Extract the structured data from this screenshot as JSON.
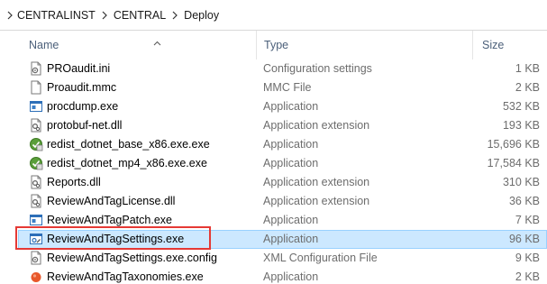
{
  "breadcrumb": {
    "items": [
      "CENTRALINST",
      "CENTRAL",
      "Deploy"
    ]
  },
  "columns": {
    "name": "Name",
    "type": "Type",
    "size": "Size",
    "sorted_by": "name",
    "sort_direction": "ascending"
  },
  "files": [
    {
      "name": "PROaudit.ini",
      "type": "Configuration settings",
      "size": "1 KB",
      "icon": "settings-file-icon",
      "selected": false
    },
    {
      "name": "Proaudit.mmc",
      "type": "MMC File",
      "size": "2 KB",
      "icon": "blank-file-icon",
      "selected": false
    },
    {
      "name": "procdump.exe",
      "type": "Application",
      "size": "532 KB",
      "icon": "application-icon",
      "selected": false
    },
    {
      "name": "protobuf-net.dll",
      "type": "Application extension",
      "size": "193 KB",
      "icon": "dll-file-icon",
      "selected": false
    },
    {
      "name": "redist_dotnet_base_x86.exe.exe",
      "type": "Application",
      "size": "15,696 KB",
      "icon": "installer-icon",
      "selected": false
    },
    {
      "name": "redist_dotnet_mp4_x86.exe.exe",
      "type": "Application",
      "size": "17,584 KB",
      "icon": "installer-icon",
      "selected": false
    },
    {
      "name": "Reports.dll",
      "type": "Application extension",
      "size": "310 KB",
      "icon": "dll-file-icon",
      "selected": false
    },
    {
      "name": "ReviewAndTagLicense.dll",
      "type": "Application extension",
      "size": "36 KB",
      "icon": "dll-file-icon",
      "selected": false
    },
    {
      "name": "ReviewAndTagPatch.exe",
      "type": "Application",
      "size": "7 KB",
      "icon": "application-icon",
      "selected": false
    },
    {
      "name": "ReviewAndTagSettings.exe",
      "type": "Application",
      "size": "96 KB",
      "icon": "app-settings-icon",
      "selected": true
    },
    {
      "name": "ReviewAndTagSettings.exe.config",
      "type": "XML Configuration File",
      "size": "9 KB",
      "icon": "config-file-icon",
      "selected": false
    },
    {
      "name": "ReviewAndTagTaxonomies.exe",
      "type": "Application",
      "size": "2 KB",
      "icon": "orange-app-icon",
      "selected": false
    }
  ],
  "colors": {
    "selection_bg": "#cce8ff",
    "selection_border": "#99d1ff",
    "highlight_border": "#e53935",
    "header_text": "#4c607a",
    "secondary_text": "#6d6d6d"
  }
}
